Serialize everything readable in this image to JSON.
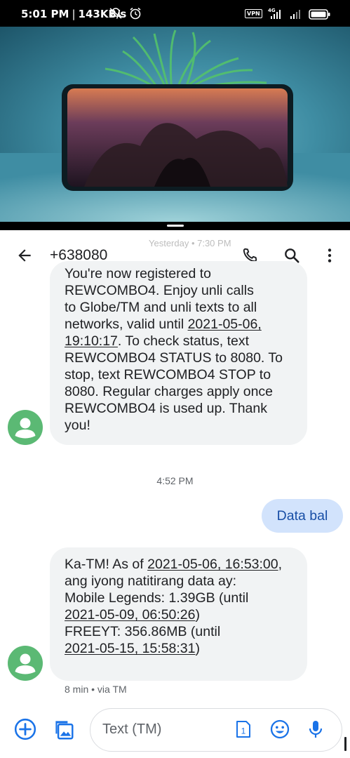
{
  "status_bar": {
    "time": "5:01 PM",
    "speed": "143KB/s",
    "vpn": "VPN",
    "network": "4G",
    "icons": [
      "silent-icon",
      "alarm-icon",
      "signal-icon",
      "signal-icon",
      "battery-icon"
    ]
  },
  "app_bar": {
    "title": "+638080",
    "faded_timestamp": "Yesterday • 7:30 PM",
    "icons": [
      "back-arrow-icon",
      "phone-icon",
      "search-icon",
      "more-vert-icon"
    ]
  },
  "messages": [
    {
      "direction": "incoming",
      "lines": [
        [
          "You're now registered to"
        ],
        [
          "REWCOMBO4. Enjoy unli calls"
        ],
        [
          "to Globe/TM and unli texts to all"
        ],
        [
          "networks, valid until ",
          {
            "u": "2021-05-06,"
          }
        ],
        [
          {
            "u": "19:10:17"
          },
          ". To check status, text"
        ],
        [
          "REWCOMBO4 STATUS to 8080. To"
        ],
        [
          "stop, text REWCOMBO4 STOP to"
        ],
        [
          "8080. Regular charges apply once"
        ],
        [
          "REWCOMBO4 is used up. Thank"
        ],
        [
          "you!"
        ]
      ]
    },
    {
      "direction": "outgoing",
      "text": "Data bal"
    },
    {
      "direction": "incoming",
      "lines": [
        [
          "Ka-TM! As of ",
          {
            "u": "2021-05-06, 16:53:00"
          },
          ","
        ],
        [
          "ang iyong natitirang data ay:"
        ],
        [
          "Mobile Legends: 1.39GB (until"
        ],
        [
          {
            "u": "2021-05-09, 06:50:26"
          },
          ")"
        ],
        [
          "FREEYT: 356.86MB (until"
        ],
        [
          {
            "u": "2021-05-15, 15:58:31"
          },
          ")"
        ]
      ]
    }
  ],
  "time_divider": "4:52 PM",
  "meta": "8 min • via TM",
  "compose": {
    "placeholder": "Text (TM)",
    "sim_number": "1",
    "icons": [
      "add-circle-icon",
      "gallery-icon",
      "sim-card-icon",
      "emoji-icon",
      "mic-icon"
    ]
  },
  "colors": {
    "accent": "#1a73e8",
    "avatar": "#5bb974",
    "incoming_bubble": "#f1f3f4",
    "outgoing_bubble": "#d2e3fc"
  }
}
